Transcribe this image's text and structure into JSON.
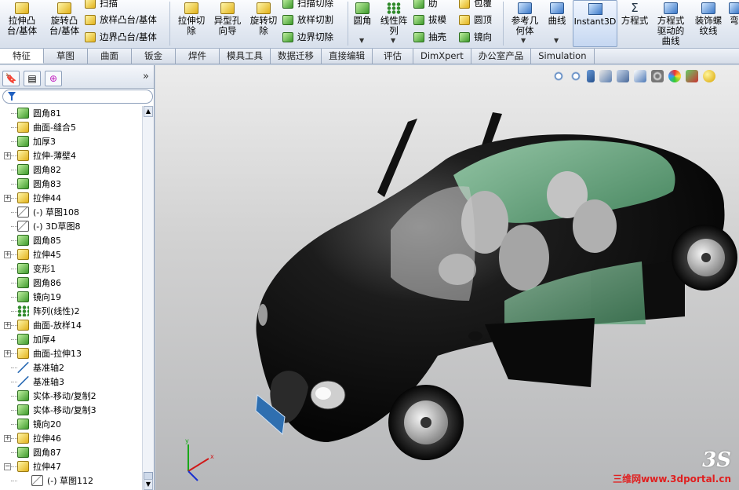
{
  "ribbon": {
    "extrude_boss": "拉伸凸\n台/基体",
    "revolve_boss": "旋转凸\n台/基体",
    "sweep": "扫描",
    "loft_boss": "放样凸台/基体",
    "boundary_boss": "边界凸台/基体",
    "extrude_cut": "拉伸切\n除",
    "hole_wizard": "异型孔\n向导",
    "revolve_cut": "旋转切\n除",
    "sweep_cut": "扫描切除",
    "loft_cut": "放样切割",
    "boundary_cut": "边界切除",
    "fillet": "圆角",
    "linear_pattern": "线性阵\n列",
    "rib": "肋",
    "draft": "拔模",
    "shell": "抽壳",
    "wrap": "包覆",
    "dome": "圆顶",
    "mirror": "镜向",
    "ref_geometry": "参考几\n何体",
    "curves": "曲线",
    "instant3d": "Instant3D",
    "equation": "方程式",
    "equation_curve": "方程式\n驱动的\n曲线",
    "cosmetic_thread": "装饰螺\n纹线",
    "bend": "弯"
  },
  "tabs": [
    "特征",
    "草图",
    "曲面",
    "钣金",
    "焊件",
    "模具工具",
    "数据迁移",
    "直接编辑",
    "评估",
    "DimXpert",
    "办公室产品",
    "Simulation"
  ],
  "panel": {
    "collapse": "»"
  },
  "tree": [
    {
      "label": "圆角81",
      "icon": "fillet-icon",
      "expand": false
    },
    {
      "label": "曲面-缝合5",
      "icon": "knit-surface-icon",
      "expand": false
    },
    {
      "label": "加厚3",
      "icon": "thicken-icon",
      "expand": false
    },
    {
      "label": "拉伸-薄壁4",
      "icon": "extrude-thin-icon",
      "expand": true
    },
    {
      "label": "圆角82",
      "icon": "fillet-icon",
      "expand": false
    },
    {
      "label": "圆角83",
      "icon": "fillet-icon",
      "expand": false
    },
    {
      "label": "拉伸44",
      "icon": "extrude-icon",
      "expand": true
    },
    {
      "label": "(-) 草图108",
      "icon": "sketch-icon",
      "expand": false
    },
    {
      "label": "(-) 3D草图8",
      "icon": "sketch3d-icon",
      "expand": false
    },
    {
      "label": "圆角85",
      "icon": "fillet-icon",
      "expand": false
    },
    {
      "label": "拉伸45",
      "icon": "extrude-icon",
      "expand": true
    },
    {
      "label": "变形1",
      "icon": "deform-icon",
      "expand": false
    },
    {
      "label": "圆角86",
      "icon": "fillet-icon",
      "expand": false
    },
    {
      "label": "镜向19",
      "icon": "mirror-icon",
      "expand": false
    },
    {
      "label": "阵列(线性)2",
      "icon": "pattern-icon",
      "expand": false
    },
    {
      "label": "曲面-放样14",
      "icon": "loft-surface-icon",
      "expand": true
    },
    {
      "label": "加厚4",
      "icon": "thicken-icon",
      "expand": false
    },
    {
      "label": "曲面-拉伸13",
      "icon": "extrude-surface-icon",
      "expand": true
    },
    {
      "label": "基准轴2",
      "icon": "axis-icon",
      "expand": false
    },
    {
      "label": "基准轴3",
      "icon": "axis-icon",
      "expand": false
    },
    {
      "label": "实体-移动/复制2",
      "icon": "move-body-icon",
      "expand": false
    },
    {
      "label": "实体-移动/复制3",
      "icon": "move-body-icon",
      "expand": false
    },
    {
      "label": "镜向20",
      "icon": "mirror-icon",
      "expand": false
    },
    {
      "label": "拉伸46",
      "icon": "extrude-icon",
      "expand": true
    },
    {
      "label": "圆角87",
      "icon": "fillet-icon",
      "expand": false
    },
    {
      "label": "拉伸47",
      "icon": "extrude-icon",
      "expand": "open"
    },
    {
      "label": "(-) 草图112",
      "icon": "sketch-icon",
      "expand": false,
      "indent": true
    }
  ],
  "watermark": {
    "site": "三维网www.3dportal.cn"
  },
  "colors": {
    "car_body": "#141414",
    "glass": "#7fcf9e",
    "viewport_top": "#ececec",
    "viewport_bottom": "#b7b8ba"
  }
}
